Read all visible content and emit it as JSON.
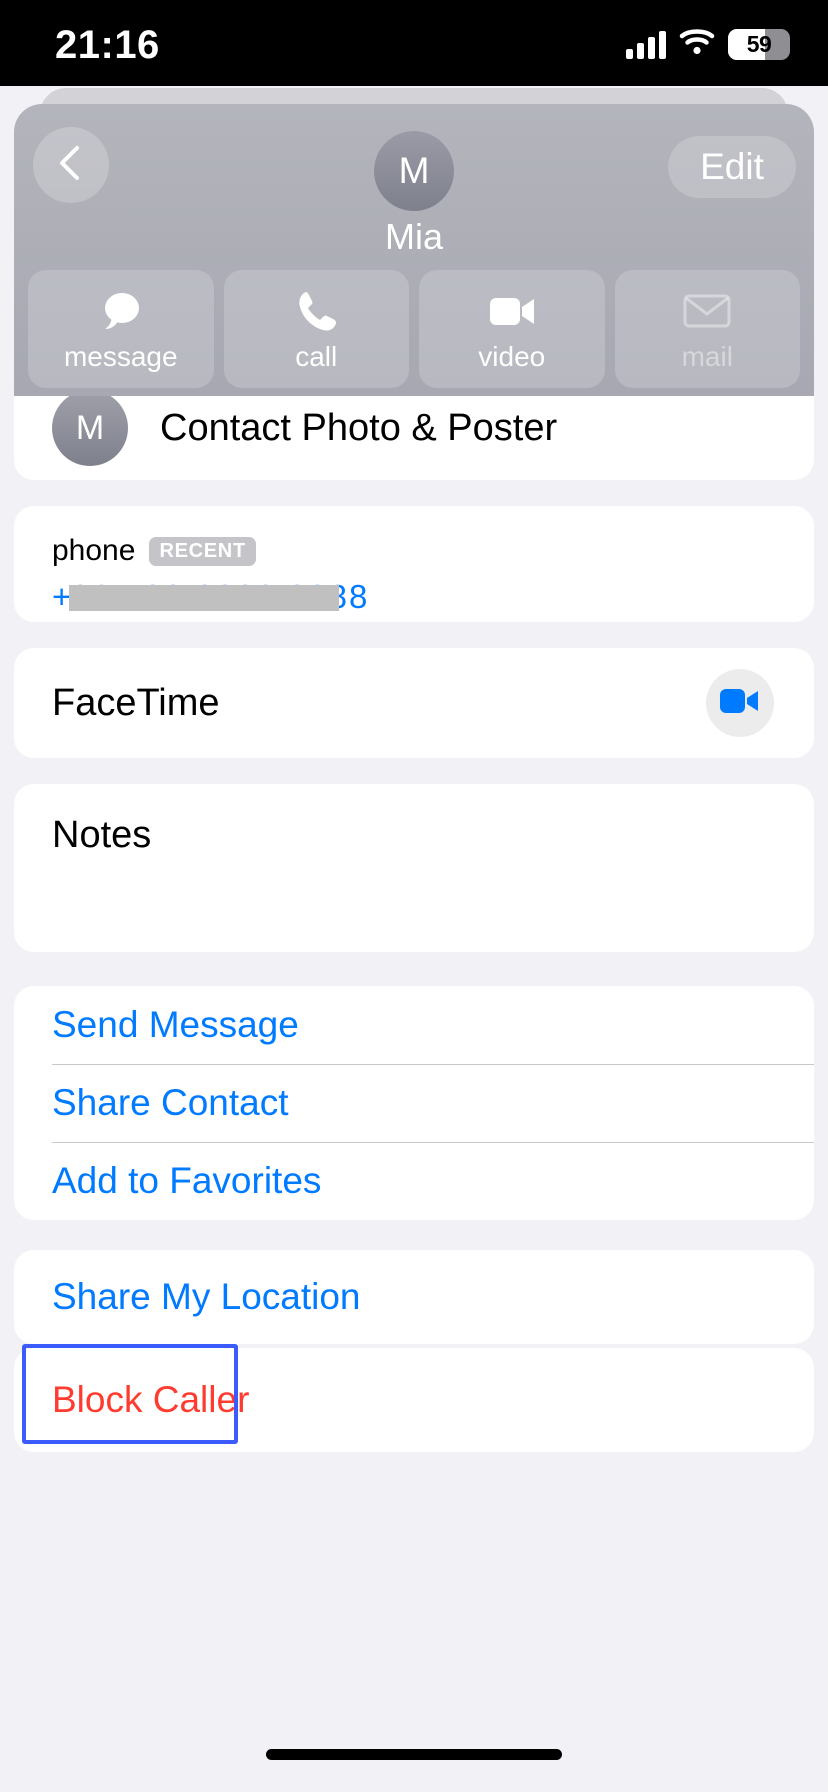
{
  "status_bar": {
    "time": "21:16",
    "battery_percent": "59",
    "cellular_icon": "cellular-bars-icon",
    "wifi_icon": "wifi-icon",
    "battery_icon": "battery-icon"
  },
  "header": {
    "back_icon": "chevron-left-icon",
    "edit_label": "Edit",
    "avatar_initial": "M",
    "contact_name": "Mia",
    "actions": [
      {
        "label": "message",
        "icon": "message-bubble-icon",
        "enabled": true
      },
      {
        "label": "call",
        "icon": "phone-icon",
        "enabled": true
      },
      {
        "label": "video",
        "icon": "video-camera-icon",
        "enabled": true
      },
      {
        "label": "mail",
        "icon": "envelope-icon",
        "enabled": false
      }
    ]
  },
  "photo_poster": {
    "avatar_initial": "M",
    "label": "Contact Photo & Poster"
  },
  "phone": {
    "label": "phone",
    "badge": "RECENT",
    "prefix": "+",
    "number": "86 138 8888 8888",
    "redacted": true
  },
  "facetime": {
    "label": "FaceTime",
    "button_icon": "video-camera-icon"
  },
  "notes": {
    "label": "Notes",
    "value": ""
  },
  "links": [
    {
      "label": "Send Message"
    },
    {
      "label": "Share Contact"
    },
    {
      "label": "Add to Favorites"
    }
  ],
  "location": {
    "label": "Share My Location"
  },
  "block": {
    "label": "Block Caller",
    "highlighted": true
  },
  "colors": {
    "accent_blue": "#007aff",
    "destructive_red": "#ff3b30",
    "highlight_box": "#3b5bfd",
    "group_background": "#f2f1f6",
    "card_background": "#ffffff"
  }
}
